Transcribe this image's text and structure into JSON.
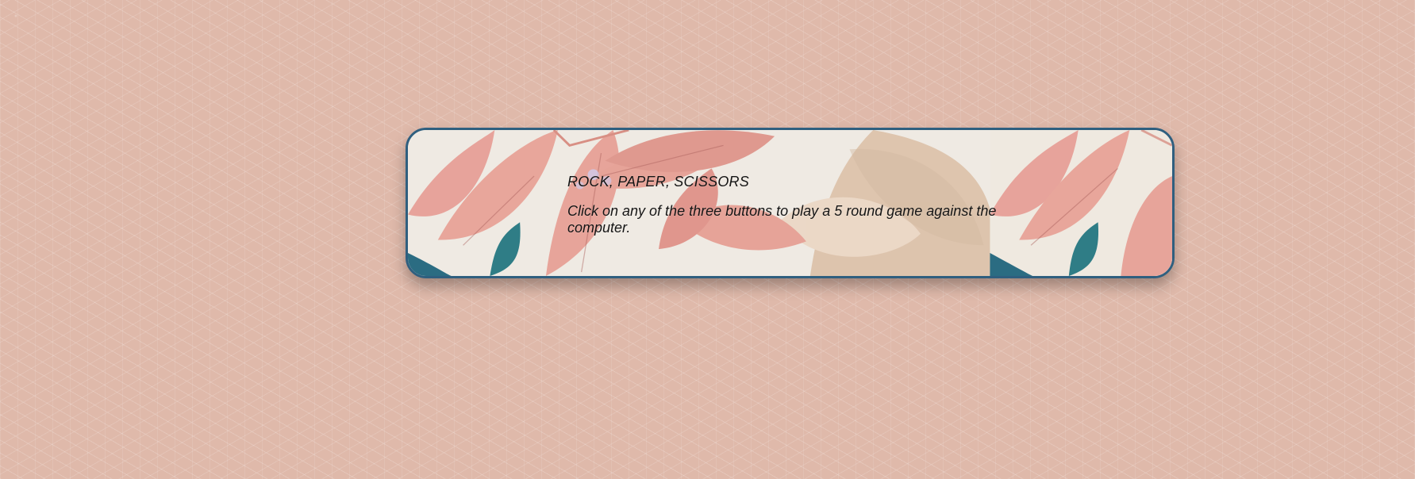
{
  "banner": {
    "title": "ROCK, PAPER, SCISSORS",
    "instructions": "Click on any of the three buttons to play a 5 round game against the computer.",
    "border_color": "#2f5f7f",
    "background_color": "#efeae3"
  },
  "page": {
    "background_color": "#dfb9aa"
  },
  "decorations": {
    "left_art": "leaf-pattern",
    "right_art": "leaf-pattern"
  }
}
